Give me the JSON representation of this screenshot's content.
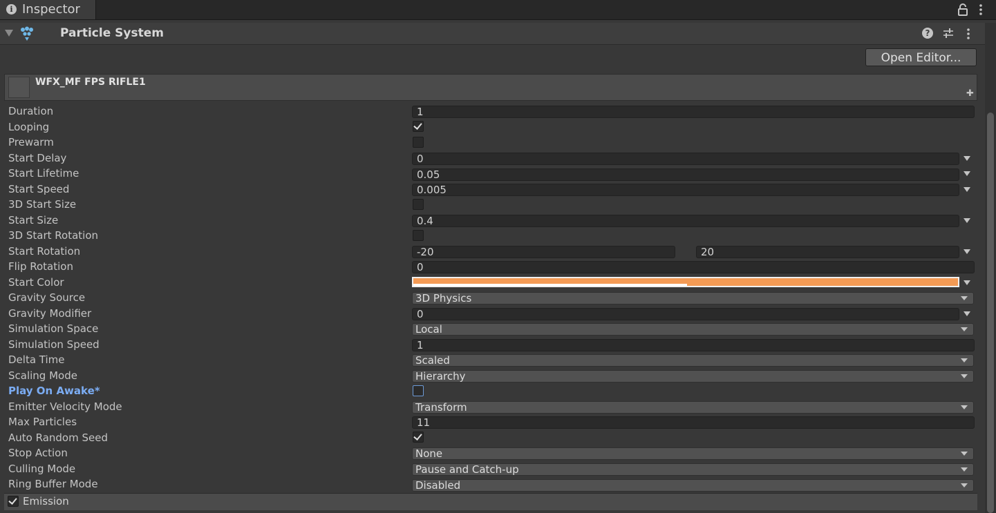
{
  "tab": {
    "title": "Inspector"
  },
  "component": {
    "title": "Particle System",
    "open_editor_label": "Open Editor..."
  },
  "module": {
    "name": "WFX_MF FPS RIFLE1"
  },
  "properties": {
    "duration": {
      "label": "Duration",
      "value": "1"
    },
    "looping": {
      "label": "Looping",
      "checked": true
    },
    "prewarm": {
      "label": "Prewarm",
      "checked": false
    },
    "start_delay": {
      "label": "Start Delay",
      "value": "0"
    },
    "start_lifetime": {
      "label": "Start Lifetime",
      "value": "0.05"
    },
    "start_speed": {
      "label": "Start Speed",
      "value": "0.005"
    },
    "start_size_3d": {
      "label": "3D Start Size",
      "checked": false
    },
    "start_size": {
      "label": "Start Size",
      "value": "0.4"
    },
    "start_rotation_3d": {
      "label": "3D Start Rotation",
      "checked": false
    },
    "start_rotation": {
      "label": "Start Rotation",
      "min": "-20",
      "max": "20"
    },
    "flip_rotation": {
      "label": "Flip Rotation",
      "value": "0"
    },
    "start_color": {
      "label": "Start Color",
      "color": "#f49b55"
    },
    "gravity_source": {
      "label": "Gravity Source",
      "value": "3D Physics"
    },
    "gravity_modifier": {
      "label": "Gravity Modifier",
      "value": "0"
    },
    "simulation_space": {
      "label": "Simulation Space",
      "value": "Local"
    },
    "simulation_speed": {
      "label": "Simulation Speed",
      "value": "1"
    },
    "delta_time": {
      "label": "Delta Time",
      "value": "Scaled"
    },
    "scaling_mode": {
      "label": "Scaling Mode",
      "value": "Hierarchy"
    },
    "play_on_awake": {
      "label": "Play On Awake*",
      "checked": false
    },
    "emitter_velocity_mode": {
      "label": "Emitter Velocity Mode",
      "value": "Transform"
    },
    "max_particles": {
      "label": "Max Particles",
      "value": "11"
    },
    "auto_random_seed": {
      "label": "Auto Random Seed",
      "checked": true
    },
    "stop_action": {
      "label": "Stop Action",
      "value": "None"
    },
    "culling_mode": {
      "label": "Culling Mode",
      "value": "Pause and Catch-up"
    },
    "ring_buffer_mode": {
      "label": "Ring Buffer Mode",
      "value": "Disabled"
    }
  },
  "emission": {
    "label": "Emission",
    "checked": true
  },
  "icons": {
    "tab": "info-icon",
    "lock": "lock-icon",
    "menu": "kebab-menu-icon",
    "component": "particle-system-icon",
    "help": "help-icon",
    "presets": "presets-sliders-icon",
    "foldout": "foldout-triangle-icon"
  },
  "colors": {
    "background": "#383838",
    "override_label": "#7bacf3",
    "start_color": "#f49b55"
  }
}
